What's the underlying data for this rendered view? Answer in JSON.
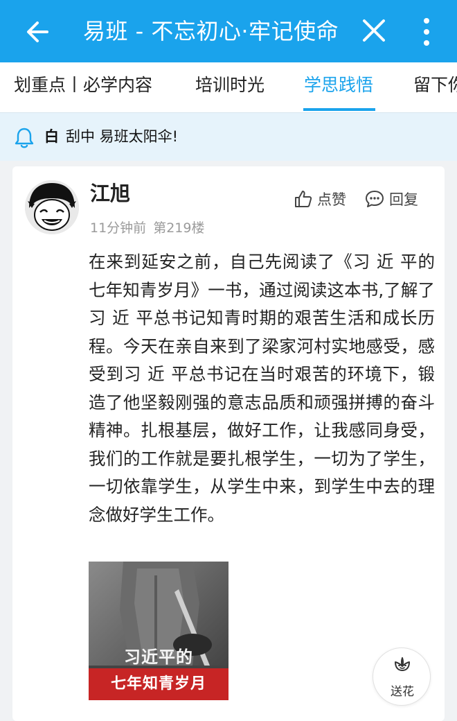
{
  "app": {
    "title": "易班 - 不忘初心·牢记使命",
    "accent_color": "#1aa3ec",
    "icons": {
      "back": "arrow-left-icon",
      "close": "close-icon",
      "more": "more-vertical-icon"
    }
  },
  "tabs": [
    {
      "label": "划重点丨必学内容",
      "active": false
    },
    {
      "label": "培训时光",
      "active": false
    },
    {
      "label": "学思践悟",
      "active": true
    },
    {
      "label": "留下你",
      "active": false
    }
  ],
  "notice": {
    "icon": "bell-icon",
    "prefix": "白",
    "text": "刮中 易班太阳伞!"
  },
  "post": {
    "author": "江旭",
    "time": "11分钟前",
    "floor": "第219楼",
    "like_label": "点赞",
    "reply_label": "回复",
    "content": "在来到延安之前，自己先阅读了《习 近 平的七年知青岁月》一书，通过阅读这本书,了解了习 近 平总书记知青时期的艰苦生活和成长历程。今天在亲自来到了梁家河村实地感受，感受到习 近 平总书记在当时艰苦的环境下，锻造了他坚毅刚强的意志品质和顽强拼搏的奋斗精神。扎根基层，做好工作，让我感同身受，我们的工作就是要扎根学生，一切为了学生，一切依靠学生，从学生中来，到学生中去的理念做好学生工作。",
    "image_caption_line1": "习近平的",
    "image_caption_line2": "七年知青岁月"
  },
  "flower_button": {
    "label": "送花",
    "icon": "flower-icon"
  }
}
